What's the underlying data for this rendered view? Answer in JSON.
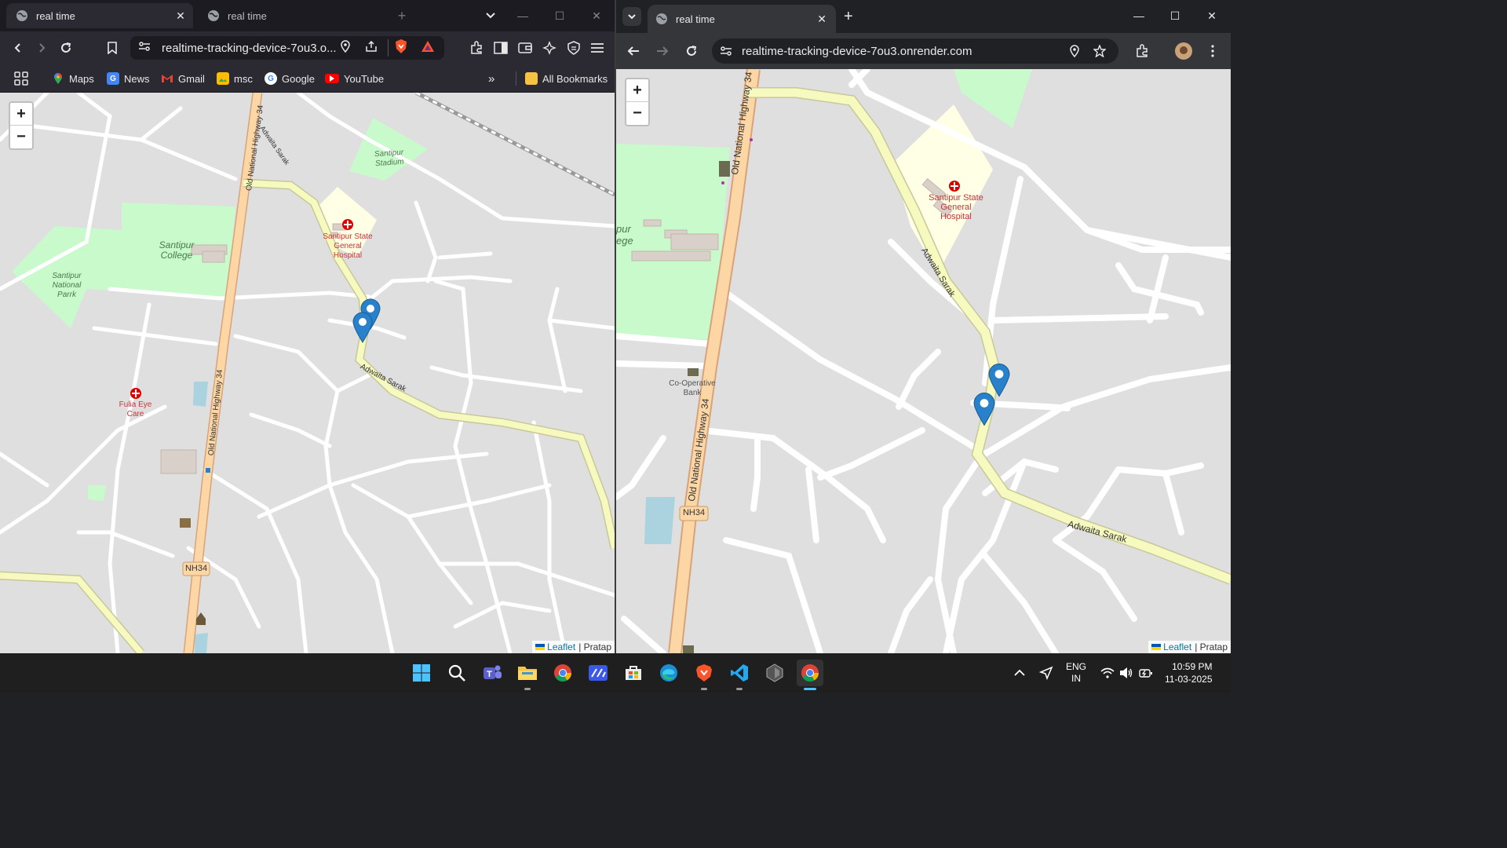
{
  "left_browser": {
    "tabs": [
      {
        "title": "real time",
        "active": true
      },
      {
        "title": "real time",
        "active": false
      }
    ],
    "url": "realtime-tracking-device-7ou3.o...",
    "bookmarks": [
      {
        "label": "Maps",
        "icon": "maps-icon"
      },
      {
        "label": "News",
        "icon": "news-icon"
      },
      {
        "label": "Gmail",
        "icon": "gmail-icon"
      },
      {
        "label": "msc",
        "icon": "folder-image-icon"
      },
      {
        "label": "Google",
        "icon": "google-icon"
      },
      {
        "label": "YouTube",
        "icon": "youtube-icon"
      }
    ],
    "all_bookmarks": "All Bookmarks",
    "map": {
      "labels": {
        "stadium": "Santipur Stadium",
        "hospital": "Santipur State General Hospital",
        "college": "Santipur College",
        "park": "Santipur National Parrk",
        "eye_care": "Fulia Eye Care",
        "highway_a": "Old National Highway 34",
        "highway_b": "Old National Highway 34",
        "adwaita_a": "Adwaita Sarak",
        "adwaita_b": "Adwaita Sarak",
        "nh": "NH34"
      },
      "zoom_in": "+",
      "zoom_out": "−",
      "attribution_link": "Leaflet",
      "attribution_text": "| Pratap"
    }
  },
  "right_browser": {
    "tab_title": "real time",
    "url": "realtime-tracking-device-7ou3.onrender.com",
    "map": {
      "labels": {
        "hospital": "Santipur State General Hospital",
        "college_partial": "pur ege",
        "highway": "Old National Highway 34",
        "adwaita_a": "Adwaita Sarak",
        "adwaita_b": "Adwaita Sarak",
        "bank": "Co-Operative Bank",
        "nh": "NH34"
      },
      "zoom_in": "+",
      "zoom_out": "−",
      "attribution_link": "Leaflet",
      "attribution_text": "| Pratap"
    }
  },
  "taskbar": {
    "apps": [
      "windows-start-icon",
      "search-icon",
      "teams-icon",
      "file-explorer-icon",
      "chrome-icon",
      "terminal-icon",
      "store-icon",
      "edge-icon",
      "brave-icon",
      "vscode-icon",
      "app-icon",
      "chrome-active-icon"
    ],
    "lang_top": "ENG",
    "lang_bottom": "IN",
    "time": "10:59 PM",
    "date": "11-03-2025"
  },
  "colors": {
    "marker": "#2a81cb",
    "major_road": "#fcd6a4",
    "secondary_road": "#f7fabf",
    "park": "#c8facc",
    "hospital_area": "#ffffe5",
    "water": "#aad3df"
  }
}
